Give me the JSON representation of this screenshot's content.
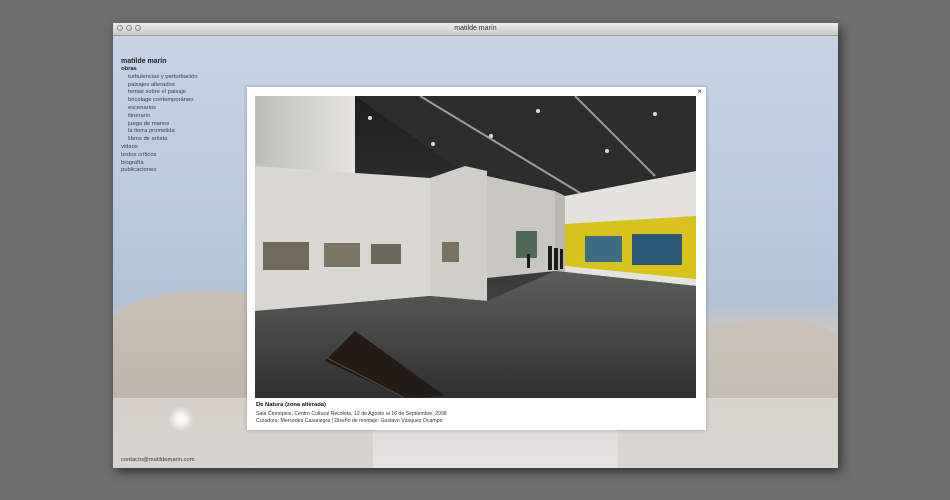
{
  "window": {
    "title": "matilde marín"
  },
  "nav": {
    "site_title": "matilde marín",
    "section": "obras",
    "sub_items": [
      "turbulencias y perturbación",
      "paisajes alterados",
      "temas sobre el paisaje",
      "bricolage contemporáneo",
      "escenarios",
      "itinerario",
      "juego de manos",
      "la tierra prometida",
      "libros de artista"
    ],
    "items": [
      "videos",
      "textos críticos",
      "biografía",
      "publicaciones"
    ],
    "contact": "contacto@matildemarin.com"
  },
  "lightbox": {
    "close_symbol": "×",
    "title": "De Natura (zona alterada)",
    "line1": "Sala Cronopios, Centro Cultural Recoleta, 12 de Agosto al 16 de Septiembre, 2008",
    "line2": "Curadora: Mercedes Casanegra | Diseño de montaje: Gustavo Vásquez Ocampo"
  }
}
